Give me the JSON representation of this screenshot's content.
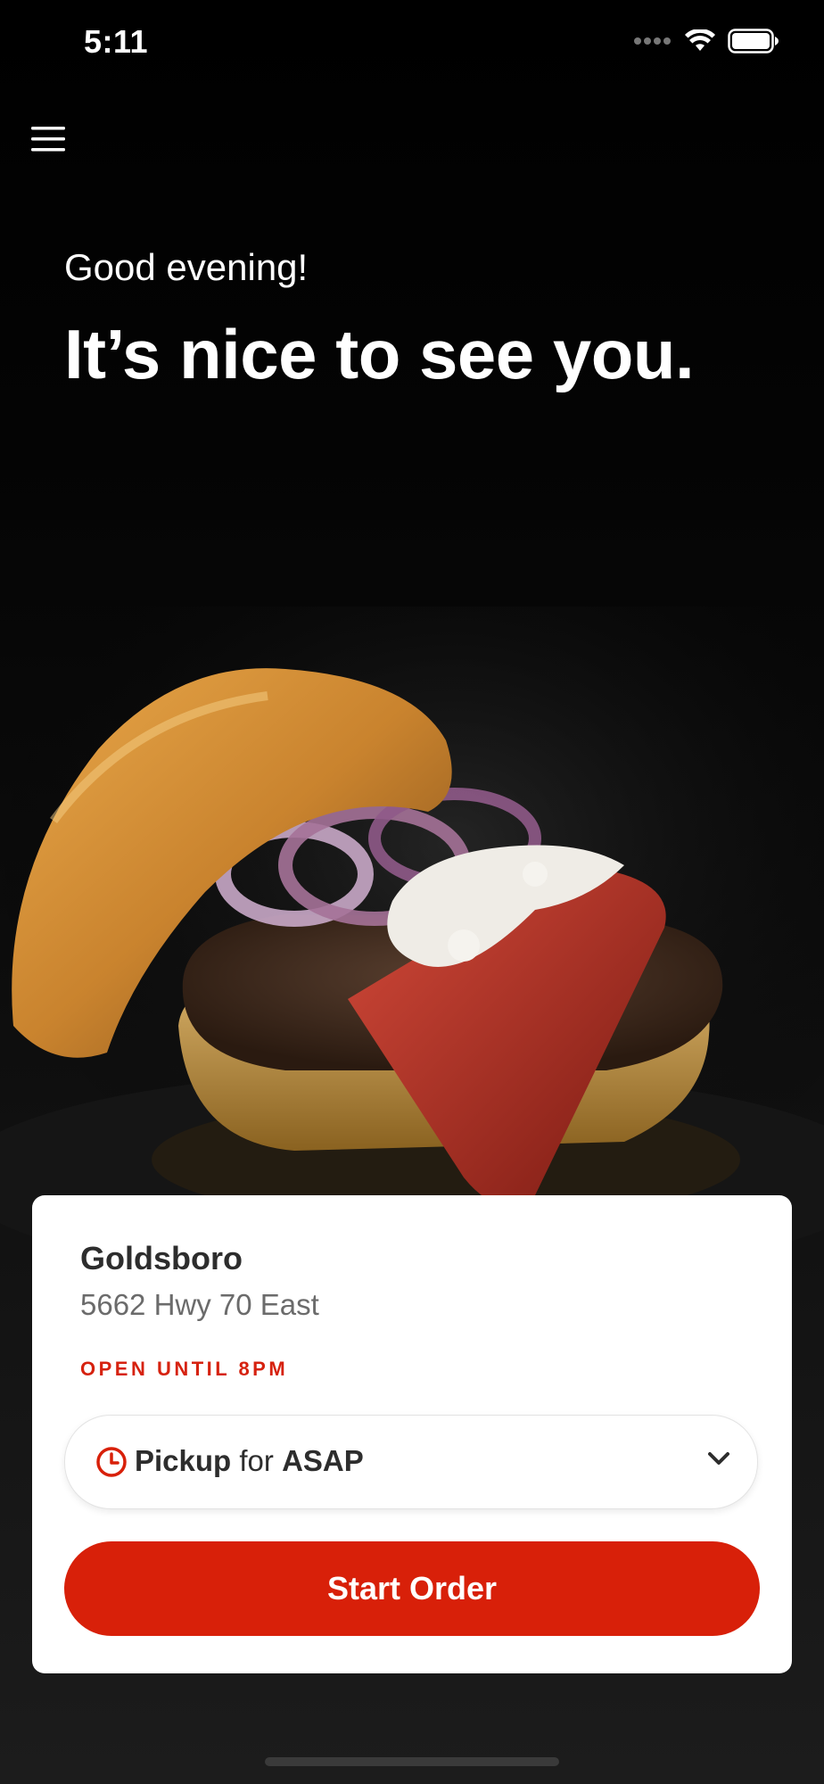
{
  "status_bar": {
    "time": "5:11"
  },
  "header": {
    "greeting": "Good evening!",
    "headline": "It’s nice to see you."
  },
  "location": {
    "name": "Goldsboro",
    "address": "5662 Hwy 70 East",
    "hours": "OPEN UNTIL 8PM"
  },
  "order_mode": {
    "mode": "Pickup",
    "connector": "for",
    "time": "ASAP"
  },
  "actions": {
    "start_order": "Start Order"
  },
  "colors": {
    "accent": "#d82009",
    "hours_text": "#d6220f",
    "background": "#000000",
    "card": "#ffffff"
  }
}
